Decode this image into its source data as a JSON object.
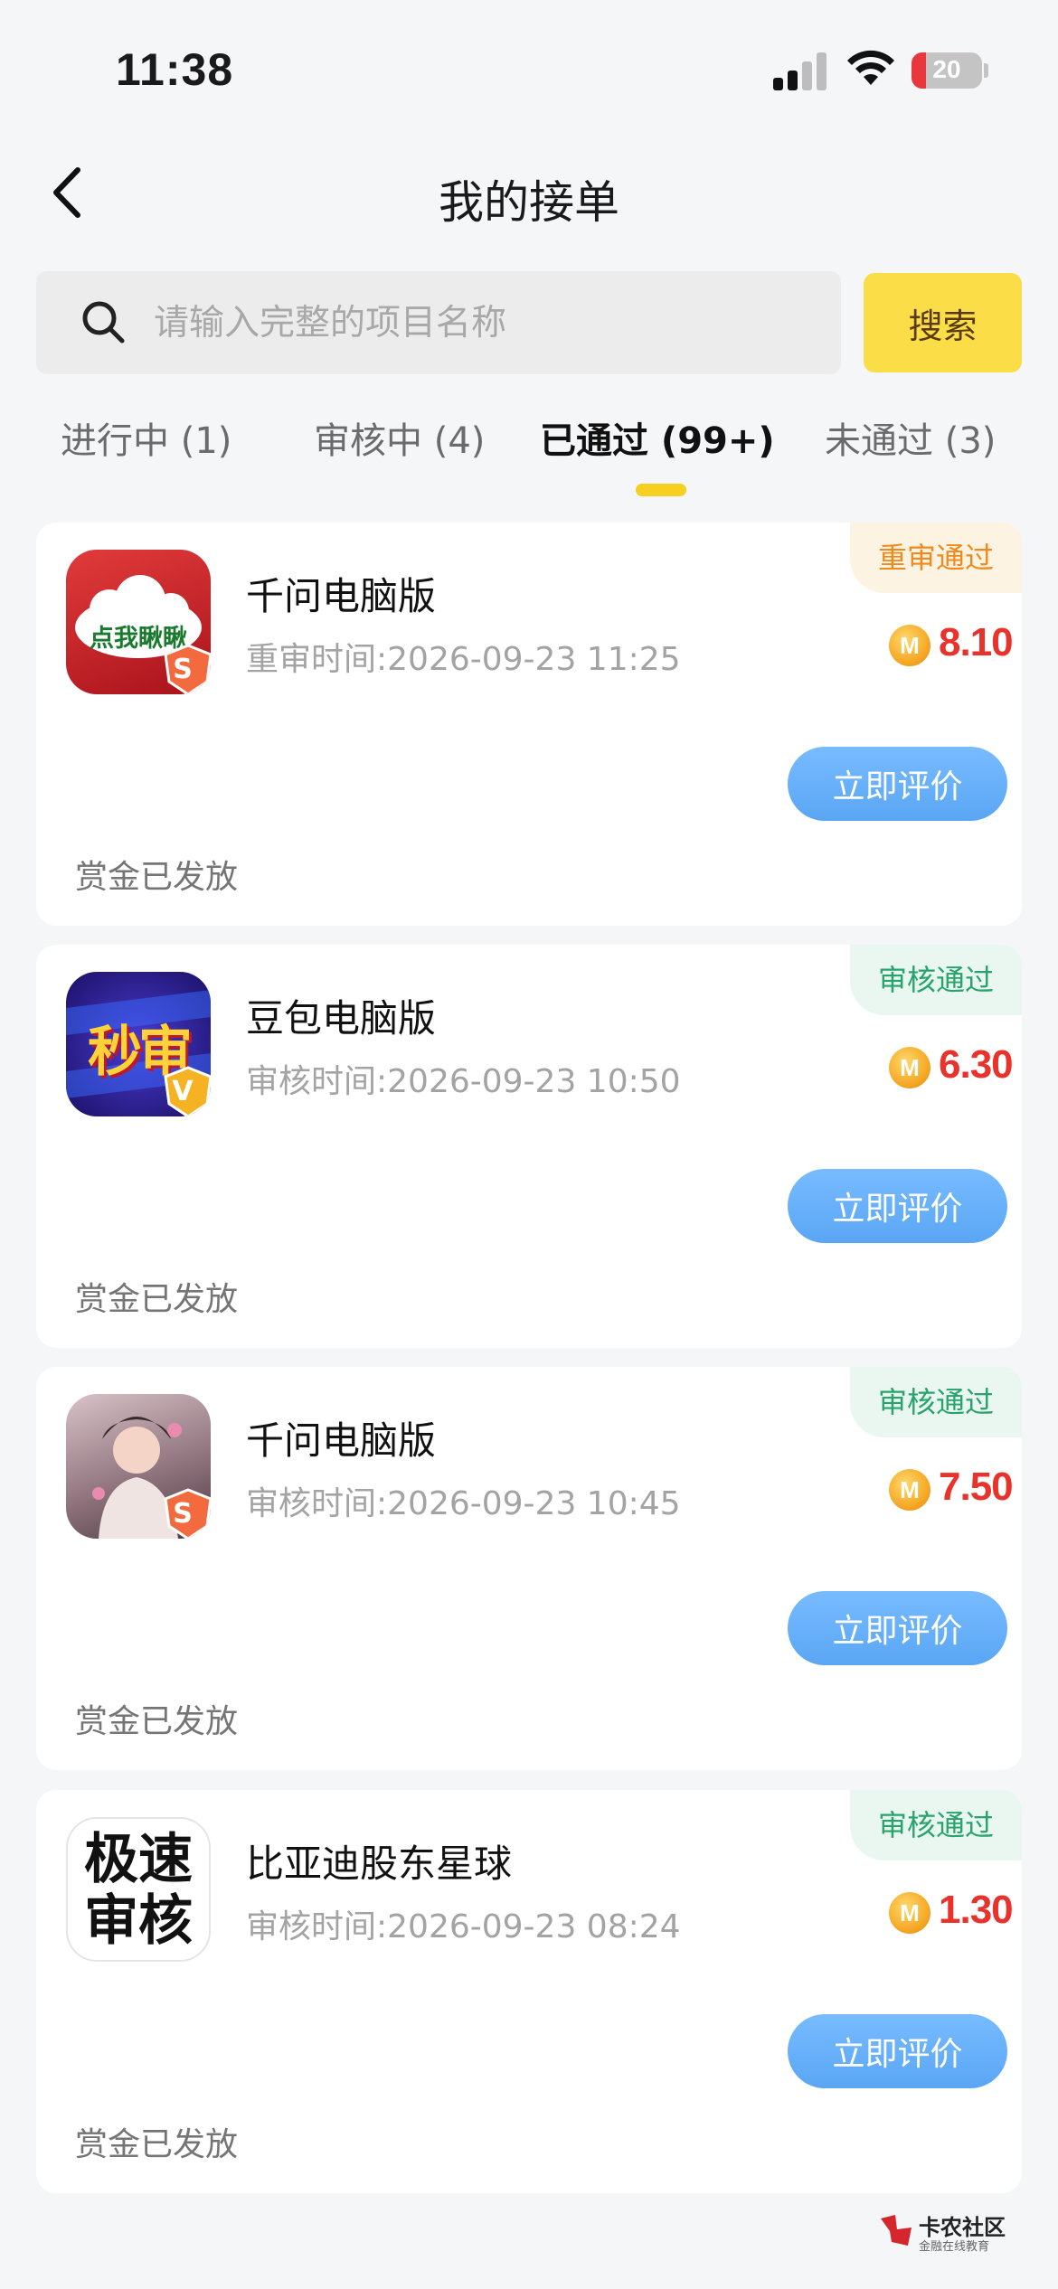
{
  "status_bar": {
    "time": "11:38",
    "battery": "20",
    "battery_level": 0.2,
    "icons": [
      "signal-icon",
      "wifi-icon",
      "battery-icon"
    ]
  },
  "nav": {
    "title": "我的接单",
    "back_icon": "chevron-left-icon"
  },
  "search": {
    "placeholder": "请输入完整的项目名称",
    "button_label": "搜索",
    "icon": "search-icon"
  },
  "tabs": [
    {
      "label": "进行中 (1)",
      "active": false
    },
    {
      "label": "审核中 (4)",
      "active": false
    },
    {
      "label": "已通过 (99+)",
      "active": true
    },
    {
      "label": "未通过 (3)",
      "active": false
    }
  ],
  "cards": [
    {
      "title": "千问电脑版",
      "time": "重审时间:2026-09-23 11:25",
      "status": "重审通过",
      "status_color": "#f08a1c",
      "coin_symbol": "M",
      "amount": "8.10",
      "button_label": "立即评价",
      "reward_text": "赏金已发放",
      "icon_text": "点我瞅瞅",
      "badge_letter": "S"
    },
    {
      "title": "豆包电脑版",
      "time": "审核时间:2026-09-23 10:50",
      "status": "审核通过",
      "status_color": "#27a36b",
      "coin_symbol": "M",
      "amount": "6.30",
      "button_label": "立即评价",
      "reward_text": "赏金已发放",
      "icon_text": "秒审",
      "badge_letter": "V"
    },
    {
      "title": "千问电脑版",
      "time": "审核时间:2026-09-23 10:45",
      "status": "审核通过",
      "status_color": "#27a36b",
      "coin_symbol": "M",
      "amount": "7.50",
      "button_label": "立即评价",
      "reward_text": "赏金已发放",
      "icon_text": "",
      "badge_letter": "S"
    },
    {
      "title": "比亚迪股东星球",
      "time": "审核时间:2026-09-23 08:24",
      "status": "审核通过",
      "status_color": "#27a36b",
      "coin_symbol": "M",
      "amount": "1.30",
      "button_label": "立即评价",
      "reward_text": "赏金已发放",
      "icon_text_line1": "极速",
      "icon_text_line2": "审核"
    }
  ],
  "watermark": {
    "title": "卡农社区",
    "subtitle": "金融在线教育"
  },
  "colors": {
    "accent_yellow": "#fbde47",
    "button_blue": "#5aa6f4",
    "amount_red": "#e8332d"
  }
}
